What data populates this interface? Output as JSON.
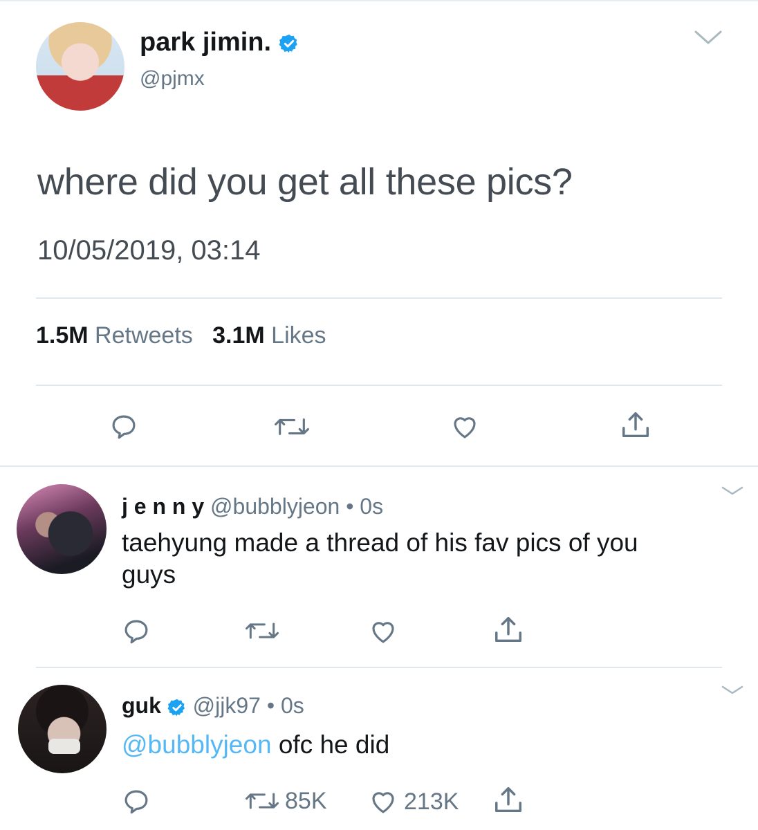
{
  "main_tweet": {
    "display_name": "park jimin.",
    "handle": "@pjmx",
    "text": "where did you get all these pics?",
    "timestamp": "10/05/2019, 03:14",
    "retweets_count": "1.5M",
    "retweets_label": "Retweets",
    "likes_count": "3.1M",
    "likes_label": "Likes",
    "icons": [
      "reply-icon",
      "retweet-icon",
      "like-icon",
      "share-icon"
    ]
  },
  "replies": [
    {
      "display_name": "j e n n y",
      "handle": "@bubblyjeon",
      "separator": "•",
      "time": "0s",
      "text_line1": "taehyung made a thread of his fav pics of you",
      "text_line2": "guys"
    },
    {
      "display_name": "guk",
      "handle": "@jjk97",
      "separator": "•",
      "time": "0s",
      "mention": "@bubblyjeon",
      "text": " ofc he did",
      "retweets": "85K",
      "likes": "213K"
    }
  ],
  "colors": {
    "verified": "#1da1f2",
    "muted": "#657786",
    "divider": "#e1e8ed"
  }
}
